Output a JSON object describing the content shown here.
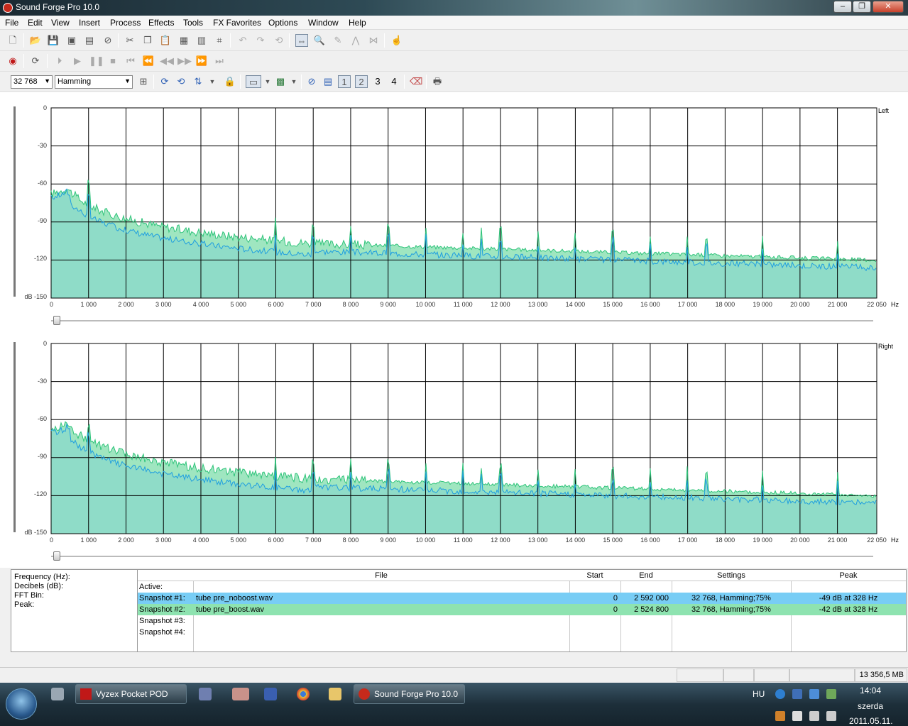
{
  "window": {
    "title": "Sound Forge Pro 10.0",
    "min": "–",
    "max": "❐",
    "close": "✕"
  },
  "menu": [
    "File",
    "Edit",
    "View",
    "Insert",
    "Process",
    "Effects",
    "Tools",
    "FX Favorites",
    "Options",
    "Window",
    "Help"
  ],
  "toolbar2": {
    "fft_size": "32 768",
    "window_fn": "Hamming",
    "graph_buttons": [
      "1",
      "2",
      "3",
      "4"
    ]
  },
  "spectrum": {
    "y_ticks": [
      "0",
      "-30",
      "-60",
      "-90",
      "-120",
      "dB -150"
    ],
    "x_ticks": [
      "0",
      "1 000",
      "2 000",
      "3 000",
      "4 000",
      "5 000",
      "6 000",
      "7 000",
      "8 000",
      "9 000",
      "10 000",
      "11 000",
      "12 000",
      "13 000",
      "14 000",
      "15 000",
      "16 000",
      "17 000",
      "18 000",
      "19 000",
      "20 000",
      "21 000",
      "22 050"
    ],
    "x_unit": "Hz",
    "channels": [
      {
        "label": "Left"
      },
      {
        "label": "Right"
      }
    ],
    "colors": {
      "snapshot1": "#1e9ee0",
      "snapshot2": "#2fc47a",
      "fill": "#8fdcc8"
    }
  },
  "info": {
    "labels": [
      "Frequency (Hz):",
      "Decibels (dB):",
      "FFT Bin:",
      "Peak:"
    ],
    "columns": [
      "File",
      "Start",
      "End",
      "Settings",
      "Peak"
    ],
    "rows": [
      {
        "name": "Active:",
        "file": "",
        "start": "",
        "end": "",
        "settings": "",
        "peak": "",
        "color": ""
      },
      {
        "name": "Snapshot #1:",
        "file": "tube pre_noboost.wav",
        "start": "0",
        "end": "2 592 000",
        "settings": "32 768, Hamming;75%",
        "peak": "-49 dB at 328 Hz",
        "color": "#78cdf5"
      },
      {
        "name": "Snapshot #2:",
        "file": "tube pre_boost.wav",
        "start": "0",
        "end": "2 524 800",
        "settings": "32 768, Hamming;75%",
        "peak": "-42 dB at 328 Hz",
        "color": "#8ee3b0"
      },
      {
        "name": "Snapshot #3:",
        "file": "",
        "start": "",
        "end": "",
        "settings": "",
        "peak": "",
        "color": ""
      },
      {
        "name": "Snapshot #4:",
        "file": "",
        "start": "",
        "end": "",
        "settings": "",
        "peak": "",
        "color": ""
      }
    ]
  },
  "status": {
    "memory": "13 356,5 MB"
  },
  "taskbar": {
    "buttons": [
      {
        "label": "Vyzex Pocket POD"
      },
      {
        "label": "Sound Forge Pro 10.0"
      }
    ],
    "lang": "HU",
    "time": "14:04",
    "day": "szerda",
    "date": "2011.05.11."
  }
}
